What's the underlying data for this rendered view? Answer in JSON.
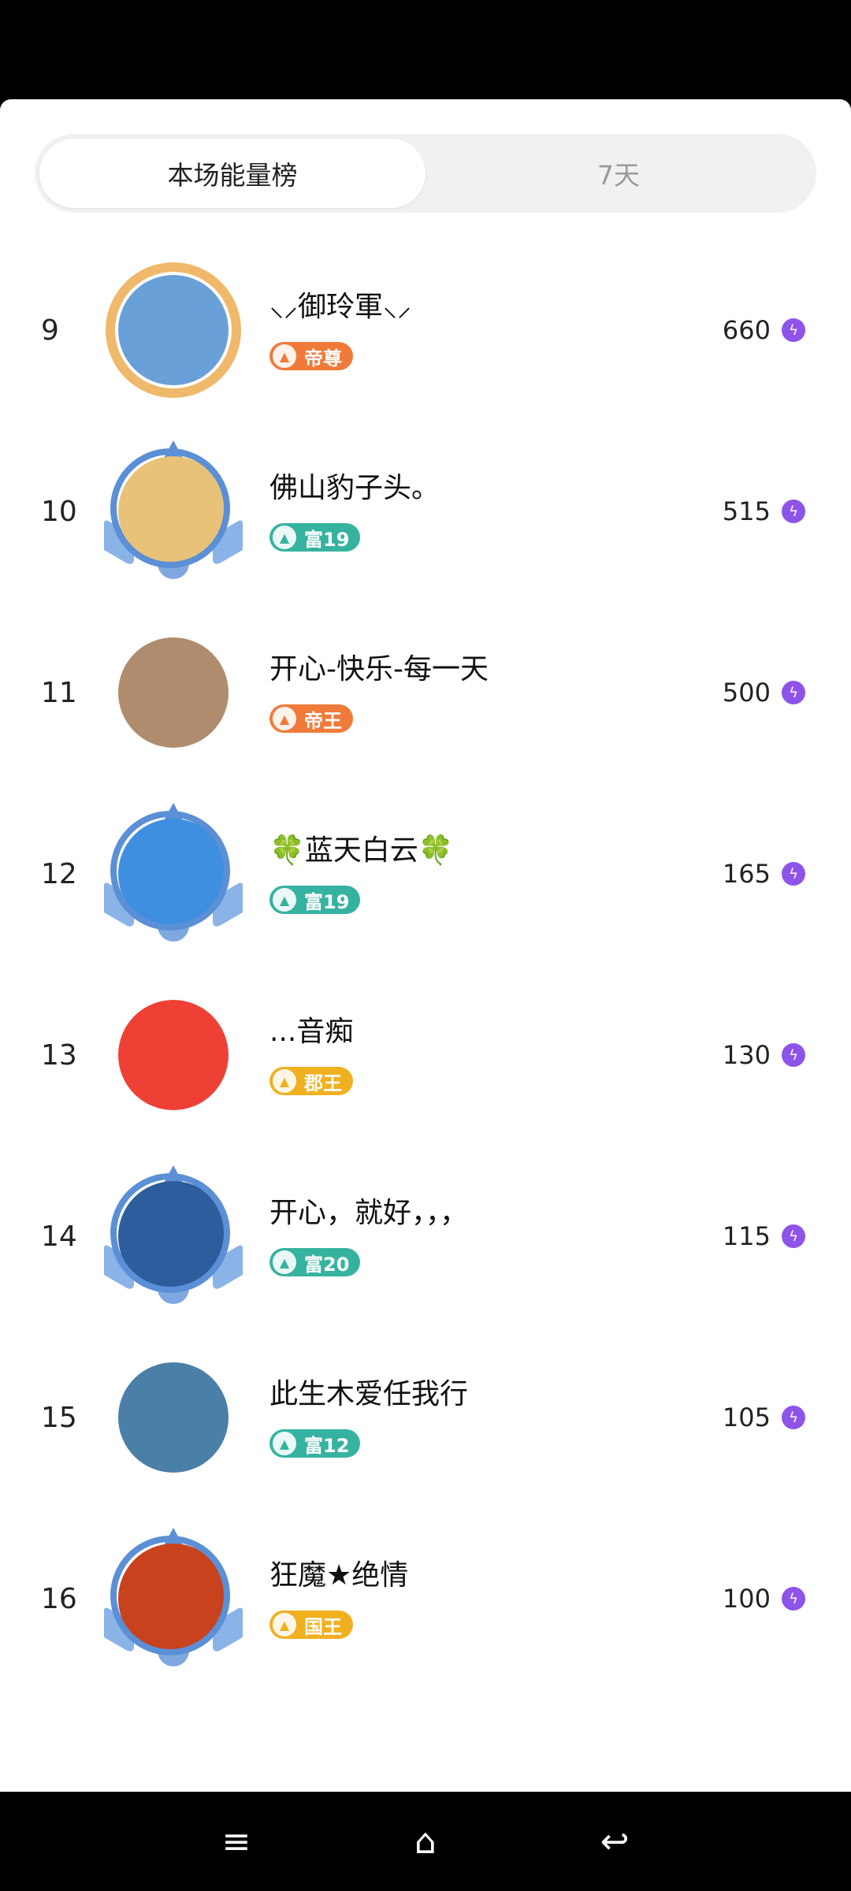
{
  "tabs": [
    {
      "label": "本场能量榜",
      "active": true
    },
    {
      "label": "7天",
      "active": false
    }
  ],
  "leaderboard": [
    {
      "rank": "9",
      "name": "⸜⸝御玲軍⸜⸝",
      "badge": "帝尊",
      "badge_color": "#f07a3a",
      "score": "660",
      "avatar_color": "#6aa0d8",
      "frame": "gold"
    },
    {
      "rank": "10",
      "name": "佛山豹子头。",
      "badge": "富19",
      "badge_color": "#35b3a0",
      "score": "515",
      "avatar_color": "#e9c27a",
      "frame": "blue"
    },
    {
      "rank": "11",
      "name": "开心-快乐-每一天",
      "badge": "帝王",
      "badge_color": "#f07a3a",
      "score": "500",
      "avatar_color": "#b08c6e",
      "frame": "none"
    },
    {
      "rank": "12",
      "name": "🍀蓝天白云🍀",
      "badge": "富19",
      "badge_color": "#35b3a0",
      "score": "165",
      "avatar_color": "#3f8fe0",
      "frame": "blue"
    },
    {
      "rank": "13",
      "name": "...音痴",
      "badge": "郡王",
      "badge_color": "#f0b020",
      "score": "130",
      "avatar_color": "#ef4036",
      "frame": "none"
    },
    {
      "rank": "14",
      "name": "开心，就好，，，",
      "badge": "富20",
      "badge_color": "#35b3a0",
      "score": "115",
      "avatar_color": "#2d5d9c",
      "frame": "blue"
    },
    {
      "rank": "15",
      "name": "此生木爱任我行",
      "badge": "富12",
      "badge_color": "#35b3a0",
      "score": "105",
      "avatar_color": "#4a7fa8",
      "frame": "none"
    },
    {
      "rank": "16",
      "name": "狂魔★绝情",
      "badge": "国王",
      "badge_color": "#f0b020",
      "score": "100",
      "avatar_color": "#c8421e",
      "frame": "blue"
    }
  ],
  "nav_icons": {
    "soft": [
      "menu-icon",
      "home-square-icon",
      "back-triangle-icon"
    ],
    "system": [
      "menu-icon",
      "home-icon",
      "back-icon"
    ]
  }
}
